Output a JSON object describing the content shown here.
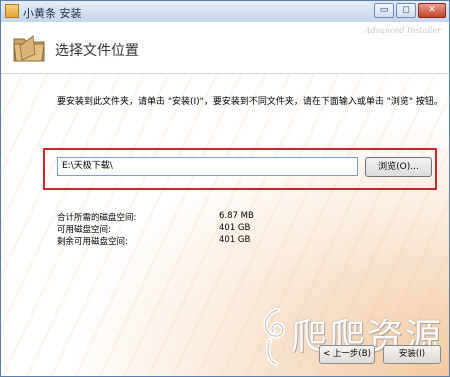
{
  "window": {
    "title": "小黄条 安装",
    "controls": [
      "▭",
      "◻",
      "✕"
    ]
  },
  "header": {
    "title": "选择文件位置",
    "brand": "Advanced Installer"
  },
  "main": {
    "instruction": "要安装到此文件夹，请单击 \"安装(I)\"，要安装到不同文件夹，请在下面输入或单击 \"浏览\" 按钮。",
    "path_value": "E:\\天极下载\\",
    "browse_label": "浏览(O)...",
    "space": [
      {
        "label": "合计所需的磁盘空间:",
        "value": "6.87 MB"
      },
      {
        "label": "可用磁盘空间:",
        "value": "401 GB"
      },
      {
        "label": "剩余可用磁盘空间:",
        "value": "401 GB"
      }
    ]
  },
  "footer": {
    "back_label": "< 上一步(B)",
    "install_label": "安装(I)"
  },
  "watermark": {
    "text": "爬爬资源"
  },
  "colors": {
    "highlight": "#d0202a",
    "titlebar": "#c6d8ec"
  }
}
